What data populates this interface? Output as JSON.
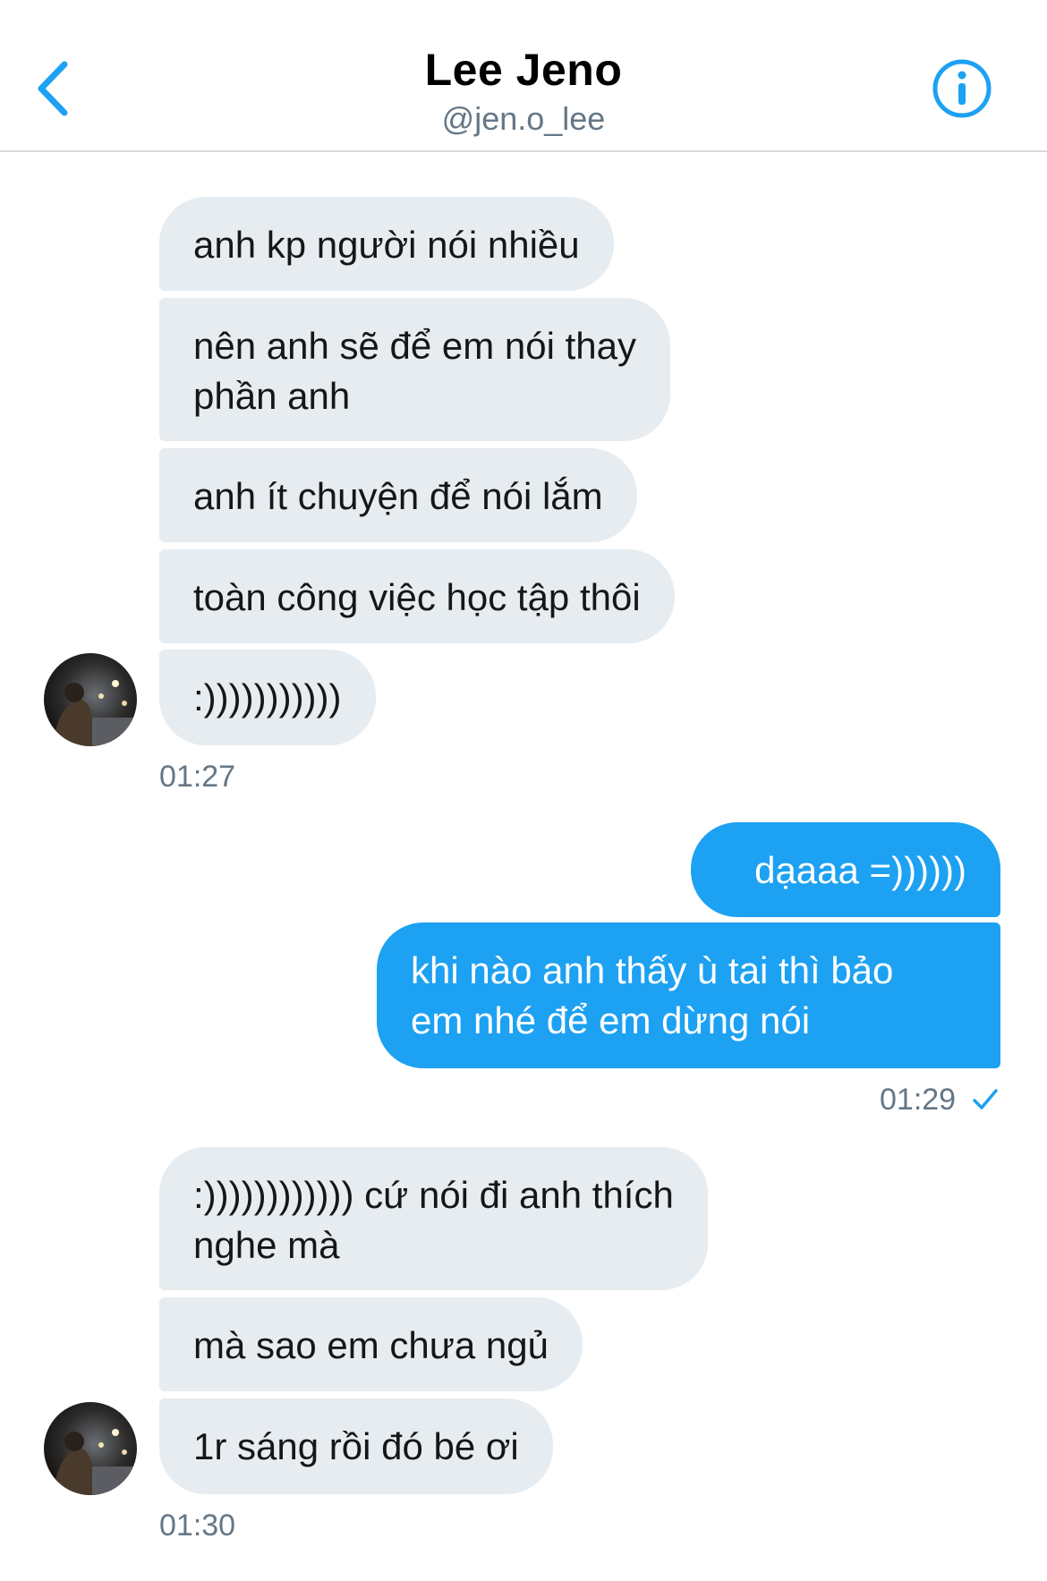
{
  "header": {
    "name": "Lee Jeno",
    "handle": "@jen.o_lee"
  },
  "messages": [
    {
      "text": "anh kp người nói nhiều"
    },
    {
      "text": "nên anh sẽ để em nói thay\nphần anh"
    },
    {
      "text": "anh ít chuyện để nói lắm"
    },
    {
      "text": "toàn công việc học tập thôi"
    },
    {
      "text": ":)))))))))))"
    },
    {
      "text": "dạaaa =))))))"
    },
    {
      "text": "khi nào anh thấy ù tai thì bảo\nem nhé để em dừng nói"
    },
    {
      "text": ":)))))))))))) cứ nói đi anh thích\nnghe mà"
    },
    {
      "text": "mà sao em chưa ngủ"
    },
    {
      "text": "1r sáng rồi đó bé ơi"
    }
  ],
  "timestamps": {
    "group1": "01:27",
    "group2": "01:29",
    "group3": "01:30"
  },
  "colors": {
    "accent": "#1da1f2",
    "incoming_bubble": "#e6ecf0",
    "muted_text": "#657786"
  },
  "icons": {
    "back": "chevron-left-icon",
    "info": "info-icon",
    "read_receipt": "checkmark-icon"
  }
}
